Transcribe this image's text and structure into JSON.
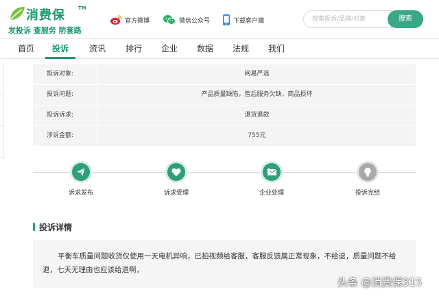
{
  "brand": {
    "title": "消费保",
    "tm": "TM",
    "slogan": "发投诉 查服务 防套路"
  },
  "top_links": {
    "weibo": "官方微博",
    "wechat": "微信公众号",
    "app": "下载客户端"
  },
  "search": {
    "placeholder": "搜索投诉/品牌/对象",
    "button": "搜索"
  },
  "nav": {
    "items": [
      "首页",
      "投诉",
      "资讯",
      "排行",
      "企业",
      "数据",
      "法规",
      "我们"
    ],
    "active_index": 1
  },
  "complaint_info": {
    "rows": [
      {
        "label": "投诉对象:",
        "value": "网易严选"
      },
      {
        "label": "投诉问题:",
        "value": "产品质量缺陷，售后服务欠缺，商品损坏"
      },
      {
        "label": "投诉诉求:",
        "value": "退货退款"
      },
      {
        "label": "涉诉金额:",
        "value": "755元"
      }
    ]
  },
  "progress": {
    "steps": [
      {
        "label": "诉求发布",
        "status": "done",
        "icon": "send-icon"
      },
      {
        "label": "诉求受理",
        "status": "done",
        "icon": "heart-icon"
      },
      {
        "label": "企业处理",
        "status": "done",
        "icon": "mail-reply-icon"
      },
      {
        "label": "投诉完结",
        "status": "todo",
        "icon": "bulb-icon"
      }
    ]
  },
  "detail": {
    "title": "投诉详情",
    "text": "平衡车质量问题收货仅使用一天电机异响，已拍视频给客服，客服反馈属正常现象，不给退，质量问题不给退，七天无理由也应该给退啊，"
  },
  "watermark": {
    "text": "头条 @消费保315"
  },
  "colors": {
    "brand_green": "#1a9a6b",
    "step_done": "#2f9e7d",
    "step_todo": "#a9a9a9",
    "search_button": "#3aa886"
  }
}
